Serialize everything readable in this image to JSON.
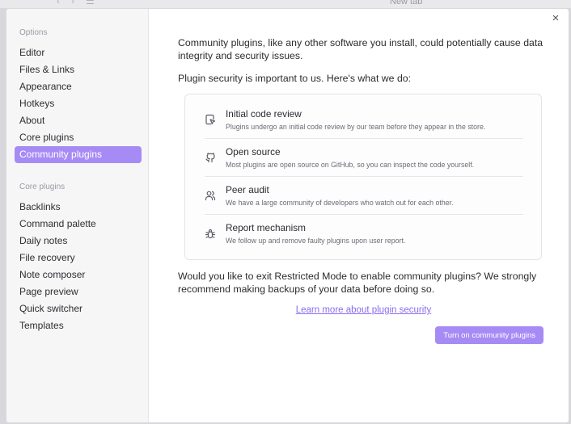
{
  "background": {
    "tab_label": "New tab"
  },
  "modal": {
    "close_label": "×"
  },
  "sidebar": {
    "options_heading": "Options",
    "options_items": [
      {
        "label": "Editor"
      },
      {
        "label": "Files & Links"
      },
      {
        "label": "Appearance"
      },
      {
        "label": "Hotkeys"
      },
      {
        "label": "About"
      },
      {
        "label": "Core plugins"
      },
      {
        "label": "Community plugins",
        "active": true
      }
    ],
    "core_heading": "Core plugins",
    "core_items": [
      {
        "label": "Backlinks"
      },
      {
        "label": "Command palette"
      },
      {
        "label": "Daily notes"
      },
      {
        "label": "File recovery"
      },
      {
        "label": "Note composer"
      },
      {
        "label": "Page preview"
      },
      {
        "label": "Quick switcher"
      },
      {
        "label": "Templates"
      }
    ]
  },
  "main": {
    "intro": "Community plugins, like any other software you install, could potentially cause data integrity and security issues.",
    "security_heading": "Plugin security is important to us. Here's what we do:",
    "features": [
      {
        "icon": "code-review-icon",
        "title": "Initial code review",
        "description": "Plugins undergo an initial code review by our team before they appear in the store."
      },
      {
        "icon": "github-icon",
        "title": "Open source",
        "description": "Most plugins are open source on GitHub, so you can inspect the code yourself."
      },
      {
        "icon": "users-icon",
        "title": "Peer audit",
        "description": "We have a large community of developers who watch out for each other."
      },
      {
        "icon": "bug-icon",
        "title": "Report mechanism",
        "description": "We follow up and remove faulty plugins upon user report."
      }
    ],
    "restricted_mode_text": "Would you like to exit Restricted Mode to enable community plugins? We strongly recommend making backups of your data before doing so.",
    "learn_more_link": "Learn more about plugin security",
    "turn_on_button": "Turn on community plugins"
  },
  "colors": {
    "accent": "#a78bf5",
    "link": "#8a6cf0",
    "sidebar_bg": "#f6f6f7"
  }
}
